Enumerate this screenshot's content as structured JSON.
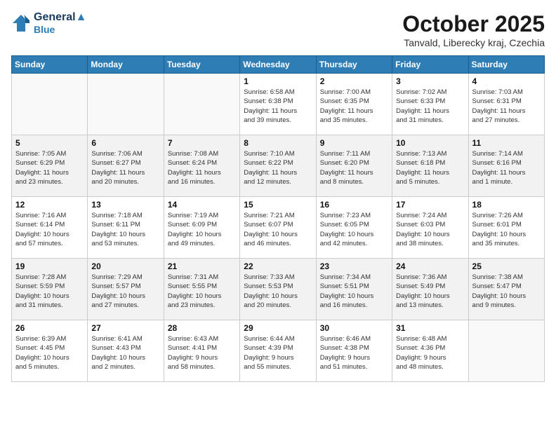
{
  "header": {
    "logo_line1": "General",
    "logo_line2": "Blue",
    "month": "October 2025",
    "location": "Tanvald, Liberecky kraj, Czechia"
  },
  "days_of_week": [
    "Sunday",
    "Monday",
    "Tuesday",
    "Wednesday",
    "Thursday",
    "Friday",
    "Saturday"
  ],
  "weeks": [
    [
      {
        "day": "",
        "text": ""
      },
      {
        "day": "",
        "text": ""
      },
      {
        "day": "",
        "text": ""
      },
      {
        "day": "1",
        "text": "Sunrise: 6:58 AM\nSunset: 6:38 PM\nDaylight: 11 hours\nand 39 minutes."
      },
      {
        "day": "2",
        "text": "Sunrise: 7:00 AM\nSunset: 6:35 PM\nDaylight: 11 hours\nand 35 minutes."
      },
      {
        "day": "3",
        "text": "Sunrise: 7:02 AM\nSunset: 6:33 PM\nDaylight: 11 hours\nand 31 minutes."
      },
      {
        "day": "4",
        "text": "Sunrise: 7:03 AM\nSunset: 6:31 PM\nDaylight: 11 hours\nand 27 minutes."
      }
    ],
    [
      {
        "day": "5",
        "text": "Sunrise: 7:05 AM\nSunset: 6:29 PM\nDaylight: 11 hours\nand 23 minutes."
      },
      {
        "day": "6",
        "text": "Sunrise: 7:06 AM\nSunset: 6:27 PM\nDaylight: 11 hours\nand 20 minutes."
      },
      {
        "day": "7",
        "text": "Sunrise: 7:08 AM\nSunset: 6:24 PM\nDaylight: 11 hours\nand 16 minutes."
      },
      {
        "day": "8",
        "text": "Sunrise: 7:10 AM\nSunset: 6:22 PM\nDaylight: 11 hours\nand 12 minutes."
      },
      {
        "day": "9",
        "text": "Sunrise: 7:11 AM\nSunset: 6:20 PM\nDaylight: 11 hours\nand 8 minutes."
      },
      {
        "day": "10",
        "text": "Sunrise: 7:13 AM\nSunset: 6:18 PM\nDaylight: 11 hours\nand 5 minutes."
      },
      {
        "day": "11",
        "text": "Sunrise: 7:14 AM\nSunset: 6:16 PM\nDaylight: 11 hours\nand 1 minute."
      }
    ],
    [
      {
        "day": "12",
        "text": "Sunrise: 7:16 AM\nSunset: 6:14 PM\nDaylight: 10 hours\nand 57 minutes."
      },
      {
        "day": "13",
        "text": "Sunrise: 7:18 AM\nSunset: 6:11 PM\nDaylight: 10 hours\nand 53 minutes."
      },
      {
        "day": "14",
        "text": "Sunrise: 7:19 AM\nSunset: 6:09 PM\nDaylight: 10 hours\nand 49 minutes."
      },
      {
        "day": "15",
        "text": "Sunrise: 7:21 AM\nSunset: 6:07 PM\nDaylight: 10 hours\nand 46 minutes."
      },
      {
        "day": "16",
        "text": "Sunrise: 7:23 AM\nSunset: 6:05 PM\nDaylight: 10 hours\nand 42 minutes."
      },
      {
        "day": "17",
        "text": "Sunrise: 7:24 AM\nSunset: 6:03 PM\nDaylight: 10 hours\nand 38 minutes."
      },
      {
        "day": "18",
        "text": "Sunrise: 7:26 AM\nSunset: 6:01 PM\nDaylight: 10 hours\nand 35 minutes."
      }
    ],
    [
      {
        "day": "19",
        "text": "Sunrise: 7:28 AM\nSunset: 5:59 PM\nDaylight: 10 hours\nand 31 minutes."
      },
      {
        "day": "20",
        "text": "Sunrise: 7:29 AM\nSunset: 5:57 PM\nDaylight: 10 hours\nand 27 minutes."
      },
      {
        "day": "21",
        "text": "Sunrise: 7:31 AM\nSunset: 5:55 PM\nDaylight: 10 hours\nand 23 minutes."
      },
      {
        "day": "22",
        "text": "Sunrise: 7:33 AM\nSunset: 5:53 PM\nDaylight: 10 hours\nand 20 minutes."
      },
      {
        "day": "23",
        "text": "Sunrise: 7:34 AM\nSunset: 5:51 PM\nDaylight: 10 hours\nand 16 minutes."
      },
      {
        "day": "24",
        "text": "Sunrise: 7:36 AM\nSunset: 5:49 PM\nDaylight: 10 hours\nand 13 minutes."
      },
      {
        "day": "25",
        "text": "Sunrise: 7:38 AM\nSunset: 5:47 PM\nDaylight: 10 hours\nand 9 minutes."
      }
    ],
    [
      {
        "day": "26",
        "text": "Sunrise: 6:39 AM\nSunset: 4:45 PM\nDaylight: 10 hours\nand 5 minutes."
      },
      {
        "day": "27",
        "text": "Sunrise: 6:41 AM\nSunset: 4:43 PM\nDaylight: 10 hours\nand 2 minutes."
      },
      {
        "day": "28",
        "text": "Sunrise: 6:43 AM\nSunset: 4:41 PM\nDaylight: 9 hours\nand 58 minutes."
      },
      {
        "day": "29",
        "text": "Sunrise: 6:44 AM\nSunset: 4:39 PM\nDaylight: 9 hours\nand 55 minutes."
      },
      {
        "day": "30",
        "text": "Sunrise: 6:46 AM\nSunset: 4:38 PM\nDaylight: 9 hours\nand 51 minutes."
      },
      {
        "day": "31",
        "text": "Sunrise: 6:48 AM\nSunset: 4:36 PM\nDaylight: 9 hours\nand 48 minutes."
      },
      {
        "day": "",
        "text": ""
      }
    ]
  ]
}
